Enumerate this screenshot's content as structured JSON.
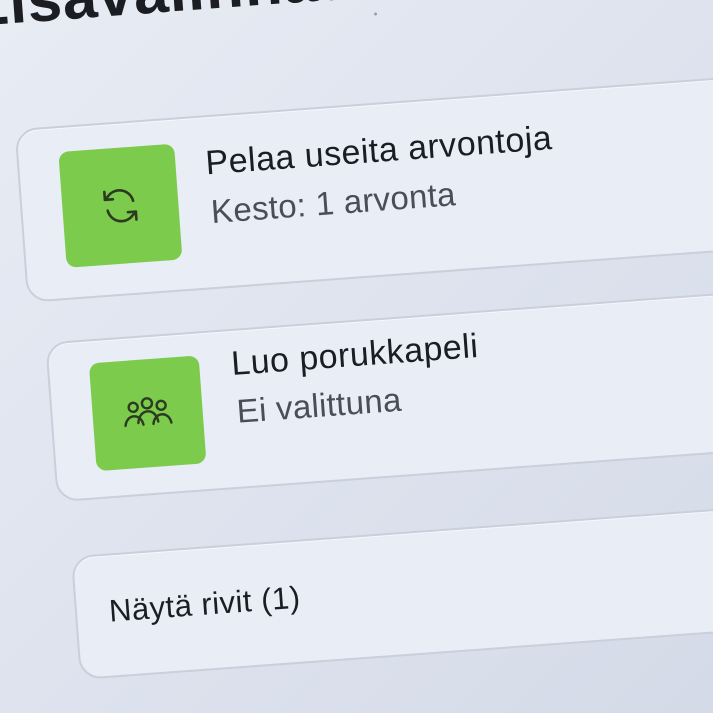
{
  "header": {
    "title": "Lisävalinnat"
  },
  "options": {
    "multi_draw": {
      "title": "Pelaa useita arvontoja",
      "subtitle": "Kesto: 1 arvonta",
      "icon": "repeat-icon",
      "icon_color": "#7ccb4d"
    },
    "group_game": {
      "title": "Luo porukkapeli",
      "subtitle": "Ei valittuna",
      "icon": "group-icon",
      "icon_color": "#7ccb4d"
    },
    "show_rows": {
      "label": "Näytä rivit (1)"
    }
  }
}
